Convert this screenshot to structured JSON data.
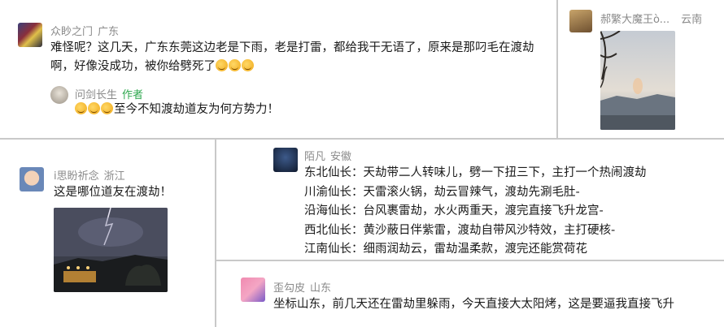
{
  "c1": {
    "user": "众眇之门",
    "location": "广东",
    "lines": [
      "难怪呢？这几天，广东东莞这边老是下雨，老是打雷，都给我干无语了，原来是那叼毛在渡劫",
      "啊，好像没成功，被你给劈死了"
    ],
    "reply": {
      "user": "问剑长生",
      "tag": "作者",
      "text": "至今不知渡劫道友为何方势力！"
    }
  },
  "c2": {
    "user": "郝繁大魔王ò...",
    "location": "云南"
  },
  "c3": {
    "user": "i思盼祈念",
    "location": "浙江",
    "text": "这是哪位道友在渡劫！"
  },
  "c4": {
    "user": "陌凡",
    "location": "安徽",
    "lines": [
      "东北仙长：天劫带二人转味儿，劈一下扭三下，主打一个热闹渡劫",
      "川渝仙长：天雷滚火锅，劫云冒辣气，渡劫先涮毛肚-",
      "沿海仙长：台风裹雷劫，水火两重天，渡完直接飞升龙宫-",
      "西北仙长：黄沙蔽日伴紫雷，渡劫自带风沙特效，主打硬核-",
      "江南仙长：细雨润劫云，雷劫温柔款，渡完还能赏荷花"
    ]
  },
  "c5": {
    "user": "歪勾皮",
    "location": "山东",
    "text": "坐标山东，前几天还在雷劫里躲雨，今天直接大太阳烤，这是要逼我直接飞升"
  }
}
